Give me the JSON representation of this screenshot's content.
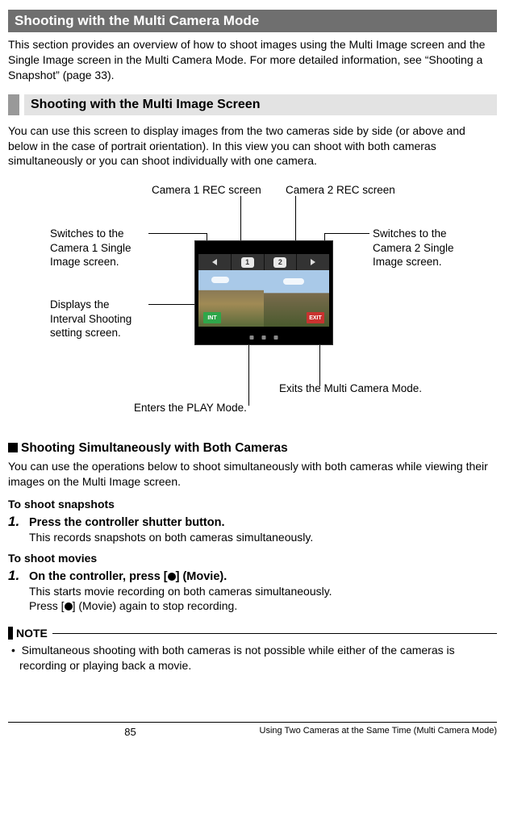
{
  "title": "Shooting with the Multi Camera Mode",
  "intro": "This section provides an overview of how to shoot images using the Multi Image screen and the Single Image screen in the Multi Camera Mode. For more detailed information, see “Shooting a Snapshot” (page 33).",
  "section1": {
    "heading": "Shooting with the Multi Image Screen",
    "body": "You can use this screen to display images from the two cameras side by side (or above and below in the case of portrait orientation). In this view you can shoot with both cameras simultaneously or you can shoot individually with one camera."
  },
  "diagram": {
    "cam1_rec": "Camera 1 REC screen",
    "cam2_rec": "Camera 2 REC screen",
    "switch1": "Switches to the Camera 1 Single Image screen.",
    "switch2": "Switches to the Camera 2 Single Image screen.",
    "interval": "Displays the Interval Shooting setting screen.",
    "exit": "Exits the Multi Camera Mode.",
    "play": "Enters the PLAY Mode.",
    "int_badge": "INT",
    "exit_badge": "EXIT",
    "cam_badge_1": "1",
    "cam_badge_2": "2"
  },
  "subsection": {
    "heading": "Shooting Simultaneously with Both Cameras",
    "body": "You can use the operations below to shoot simultaneously with both cameras while viewing their images on the Multi Image screen."
  },
  "snapshots": {
    "heading": "To shoot snapshots",
    "step_num": "1.",
    "step_title": "Press the controller shutter button.",
    "step_body": "This records snapshots on both cameras simultaneously."
  },
  "movies": {
    "heading": "To shoot movies",
    "step_num": "1.",
    "step_title_a": "On the controller, press [",
    "step_title_b": "] (Movie).",
    "step_body_1": "This starts movie recording on both cameras simultaneously.",
    "step_body_2a": "Press [",
    "step_body_2b": "] (Movie) again to stop recording."
  },
  "note": {
    "label": "NOTE",
    "body": "•  Simultaneous shooting with both cameras is not possible while either of the cameras is recording or playing back a movie."
  },
  "footer": {
    "page": "85",
    "text": "Using Two Cameras at the Same Time (Multi Camera Mode)"
  }
}
